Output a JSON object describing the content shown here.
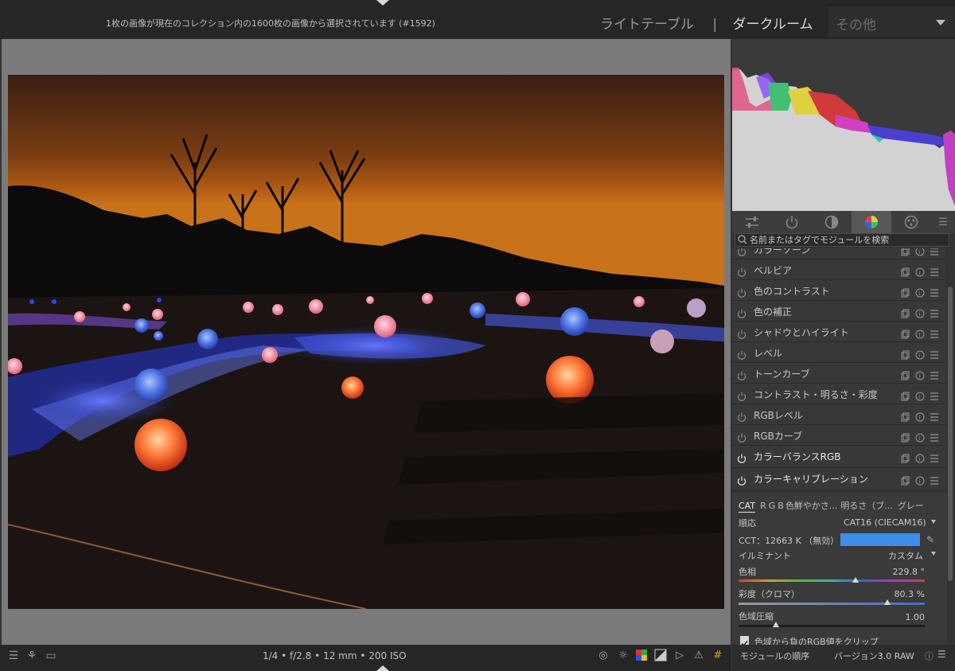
{
  "topbar": {
    "status": "1枚の画像が現在のコレクション内の1600枚の画像から選択されています (#1592)",
    "views": [
      "ライトテーブル",
      "ダークルーム"
    ],
    "views_active": "ダークルーム",
    "separator": "|",
    "other_label": "その他"
  },
  "bottombar": {
    "exif": "1/4 • f/2.8 • 12 mm • 200 ISO"
  },
  "search": {
    "placeholder": "名前またはタグでモジュールを検索"
  },
  "modules": [
    {
      "name": "カラーゾーン",
      "on": false
    },
    {
      "name": "ベルビア",
      "on": false
    },
    {
      "name": "色のコントラスト",
      "on": false
    },
    {
      "name": "色の補正",
      "on": false
    },
    {
      "name": "シャドウとハイライト",
      "on": false
    },
    {
      "name": "レベル",
      "on": false
    },
    {
      "name": "トーンカーブ",
      "on": false
    },
    {
      "name": "コントラスト・明るさ・彩度",
      "on": false
    },
    {
      "name": "RGBレベル",
      "on": false
    },
    {
      "name": "RGBカーブ",
      "on": false
    },
    {
      "name": "カラーバランスRGB",
      "on": true
    },
    {
      "name": "カラーキャリブレーション",
      "on": true
    }
  ],
  "calibration": {
    "tabs": [
      "CAT",
      "R",
      "G",
      "B",
      "色鮮やかさ...",
      "明るさ（ブ...",
      "グレー"
    ],
    "adaptation_label": "順応",
    "adaptation_value": "CAT16 (CIECAM16)",
    "cct_label": "CCT：12663 K （無効）",
    "cct_color": "#3d8fe8",
    "illuminant_label": "イルミナント",
    "illuminant_value": "カスタム",
    "hue_label": "色相",
    "hue_value": "229.8 °",
    "hue_fraction": 0.63,
    "chroma_label": "彩度（クロマ）",
    "chroma_value": "80.3 %",
    "chroma_fraction": 0.8,
    "gamut_label": "色域圧縮",
    "gamut_value": "1.00",
    "gamut_fraction": 0.2,
    "clip_label": "色域から負のRGB値をクリップ",
    "clip_checked": true
  },
  "footer": {
    "module_order": "モジュールの順序",
    "version": "バージョン3.0 RAW"
  },
  "icons": {
    "tab_icons": [
      "sliders-icon",
      "power-icon",
      "tone-icon",
      "color-icon",
      "effects-icon",
      "menu-icon"
    ],
    "bottom_left": [
      "menu-icon",
      "styles-icon",
      "display-icon"
    ],
    "bottom_right": [
      "focus-peaking-icon",
      "bulb-icon",
      "color-assessment-icon",
      "overexposed-icon",
      "raw-overexposed-icon",
      "gamut-check-icon",
      "guides-icon"
    ]
  }
}
